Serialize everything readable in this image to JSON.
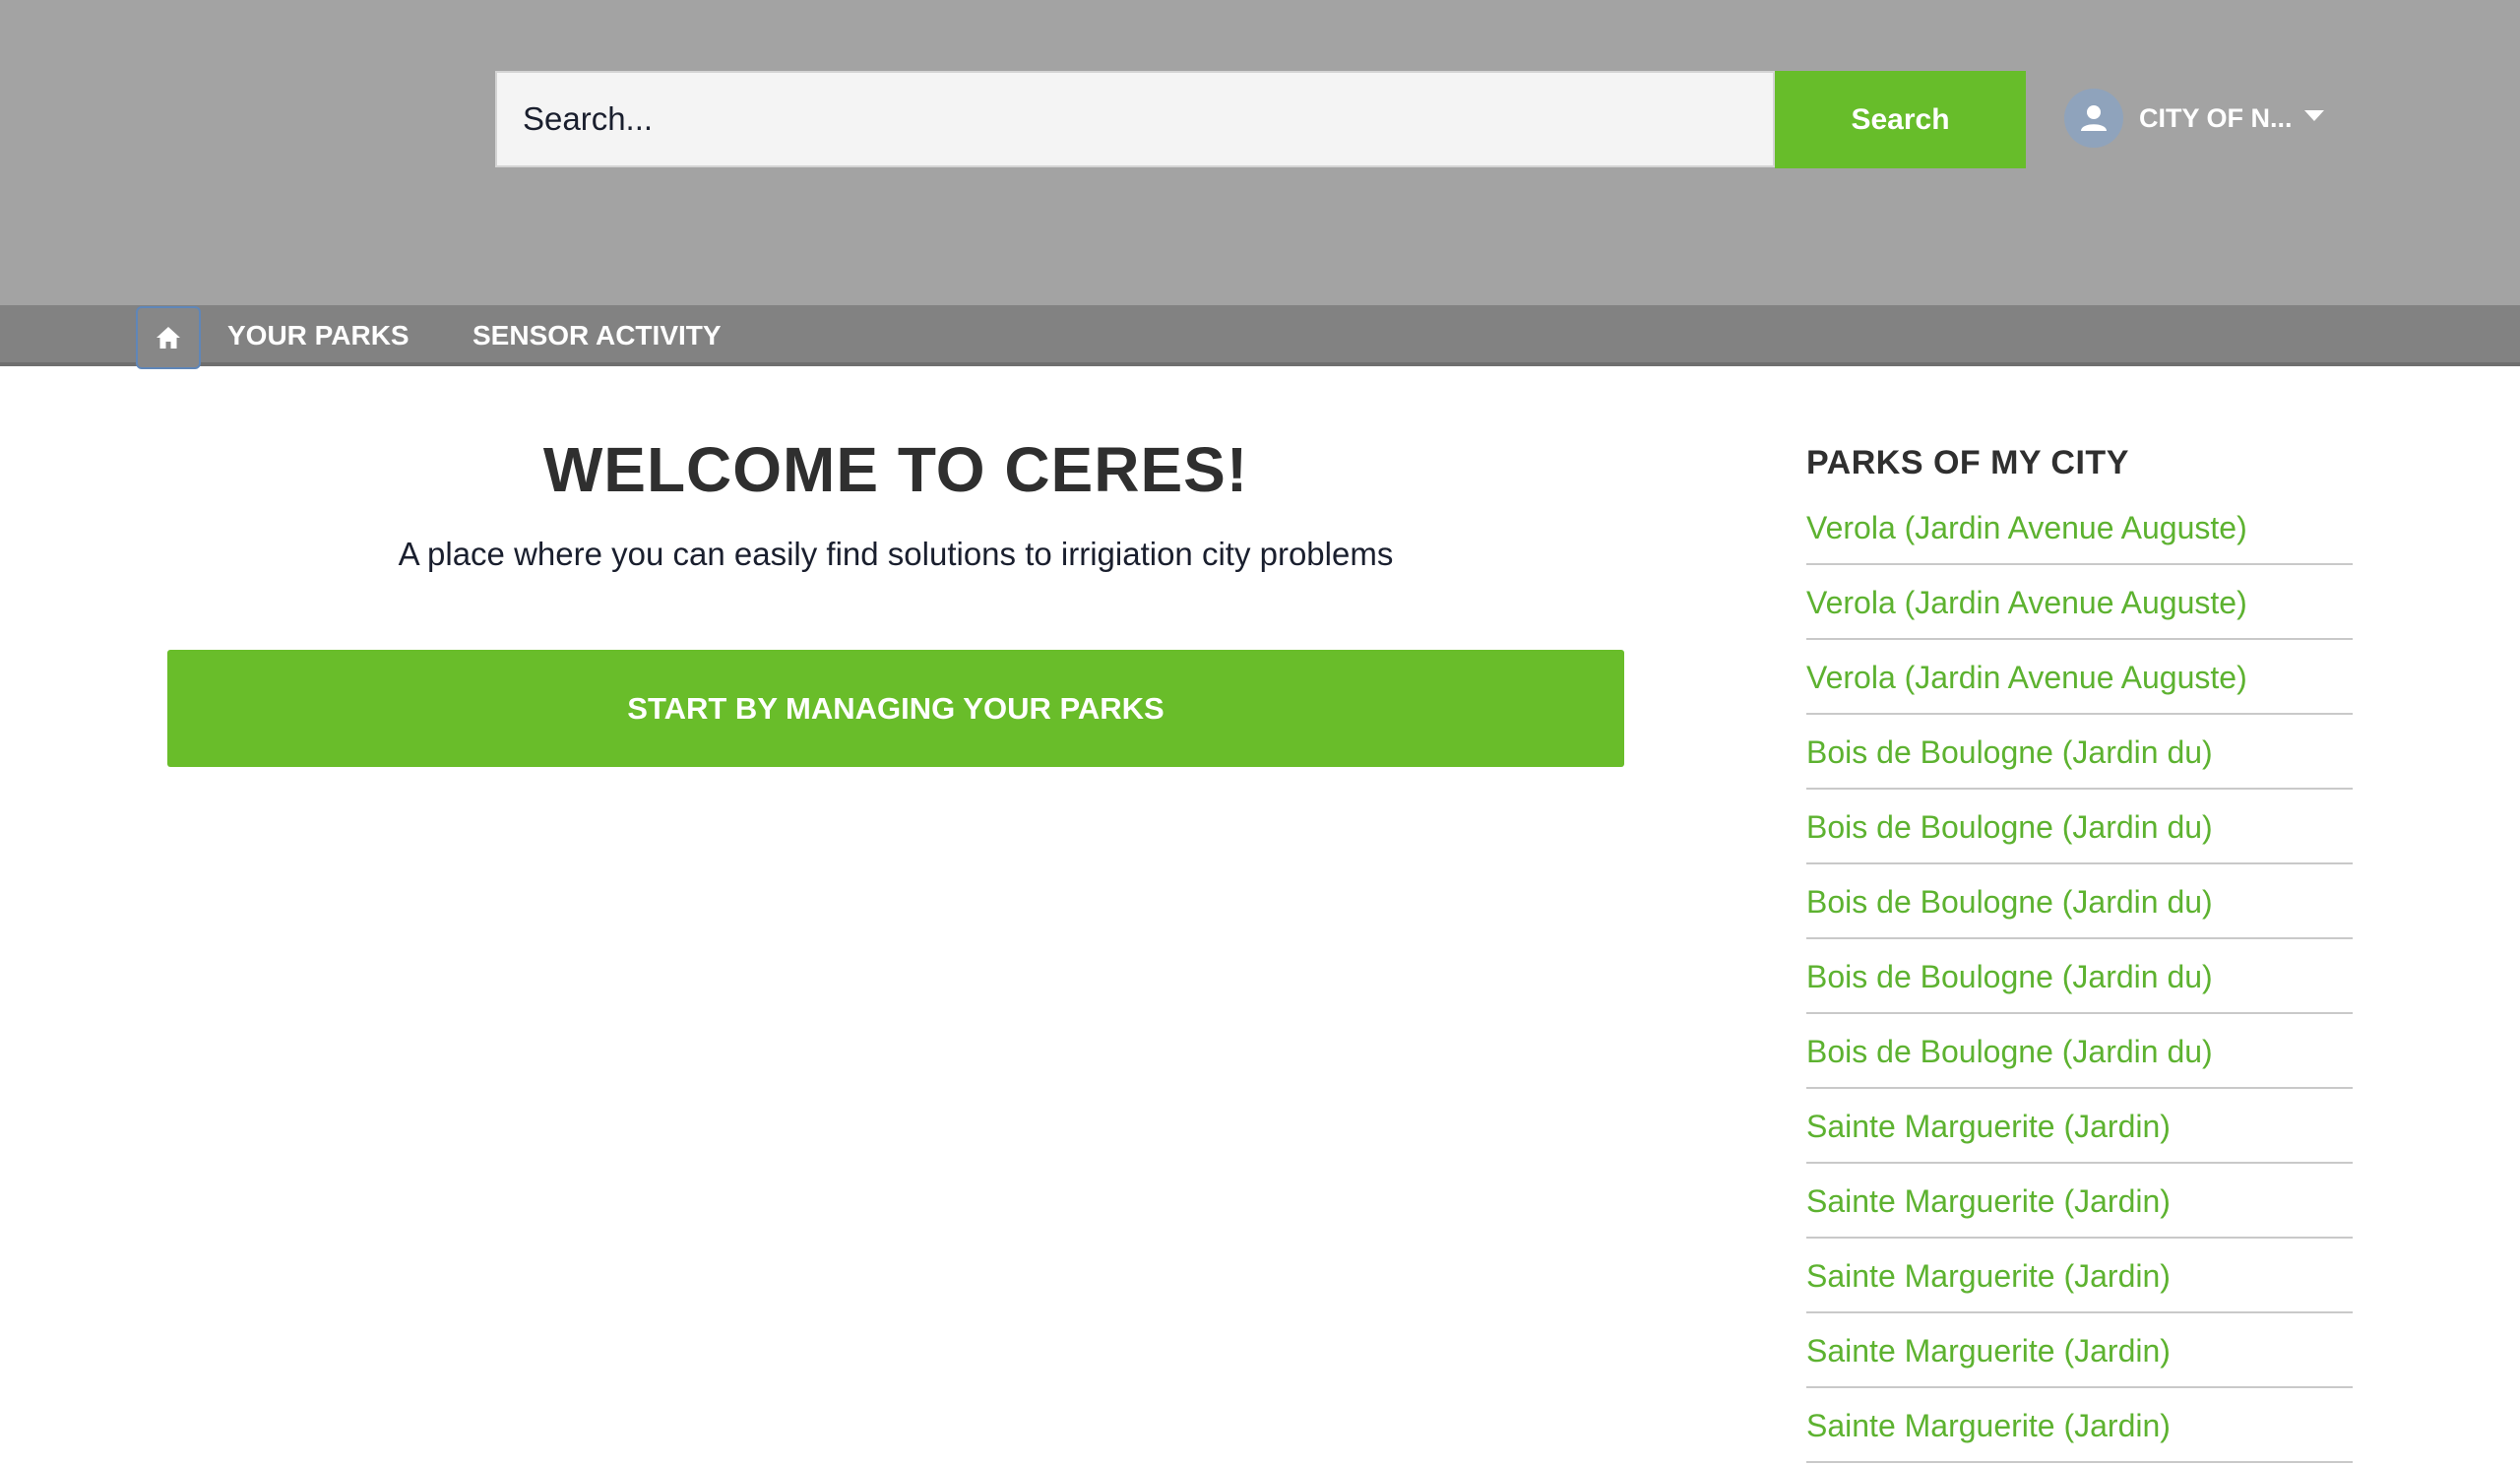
{
  "header": {
    "search_placeholder": "Search...",
    "search_button": "Search",
    "user_name": "CITY OF N...",
    "accent_color": "#67bd2a"
  },
  "nav": {
    "home_icon": "home-icon",
    "items": [
      {
        "label": "YOUR PARKS"
      },
      {
        "label": "SENSOR ACTIVITY"
      }
    ]
  },
  "main": {
    "title": "WELCOME TO CERES!",
    "subtitle": "A place where you can easily find solutions to irrigiation city problems",
    "cta_label": "START BY MANAGING YOUR PARKS"
  },
  "sidebar": {
    "title": "PARKS OF MY CITY",
    "parks": [
      "Verola (Jardin Avenue Auguste)",
      "Verola (Jardin Avenue Auguste)",
      "Verola (Jardin Avenue Auguste)",
      "Bois de Boulogne (Jardin du)",
      "Bois de Boulogne (Jardin du)",
      "Bois de Boulogne (Jardin du)",
      "Bois de Boulogne (Jardin du)",
      "Bois de Boulogne (Jardin du)",
      "Sainte Marguerite (Jardin)",
      "Sainte Marguerite (Jardin)",
      "Sainte Marguerite (Jardin)",
      "Sainte Marguerite (Jardin)",
      "Sainte Marguerite (Jardin)"
    ]
  }
}
